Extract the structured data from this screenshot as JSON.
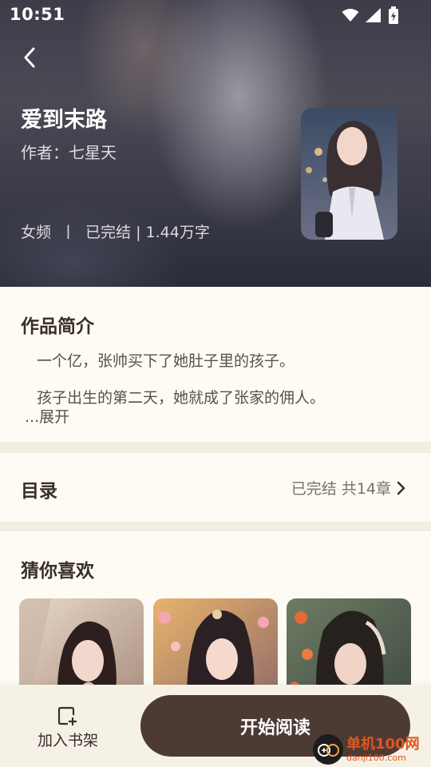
{
  "status_bar": {
    "time": "10:51"
  },
  "book": {
    "title": "爱到末路",
    "author_label": "作者：",
    "author": "七星天",
    "category": "女频",
    "separator": "丨",
    "status_words": "已完结 | 1.44万字"
  },
  "intro": {
    "heading": "作品简介",
    "paragraphs": [
      "一个亿，张帅买下了她肚子里的孩子。",
      "孩子出生的第二天，她就成了张家的佣人。"
    ],
    "expand_label": "...展开"
  },
  "catalog": {
    "heading": "目录",
    "summary": "已完结 共14章"
  },
  "recommend": {
    "heading": "猜你喜欢"
  },
  "bottom_bar": {
    "bookshelf_label": "加入书架",
    "read_label": "开始阅读"
  },
  "watermark": {
    "name": "单机100网",
    "url": "danji100.com"
  },
  "colors": {
    "primary_button": "#4e3a35",
    "page_background": "#fdfbf4",
    "section_divider": "#f3eee2",
    "watermark": "#e0571e"
  },
  "icons": [
    "back-arrow-icon",
    "wifi-icon",
    "signal-icon",
    "battery-charging-icon",
    "chevron-right-icon",
    "bookshelf-add-icon"
  ]
}
